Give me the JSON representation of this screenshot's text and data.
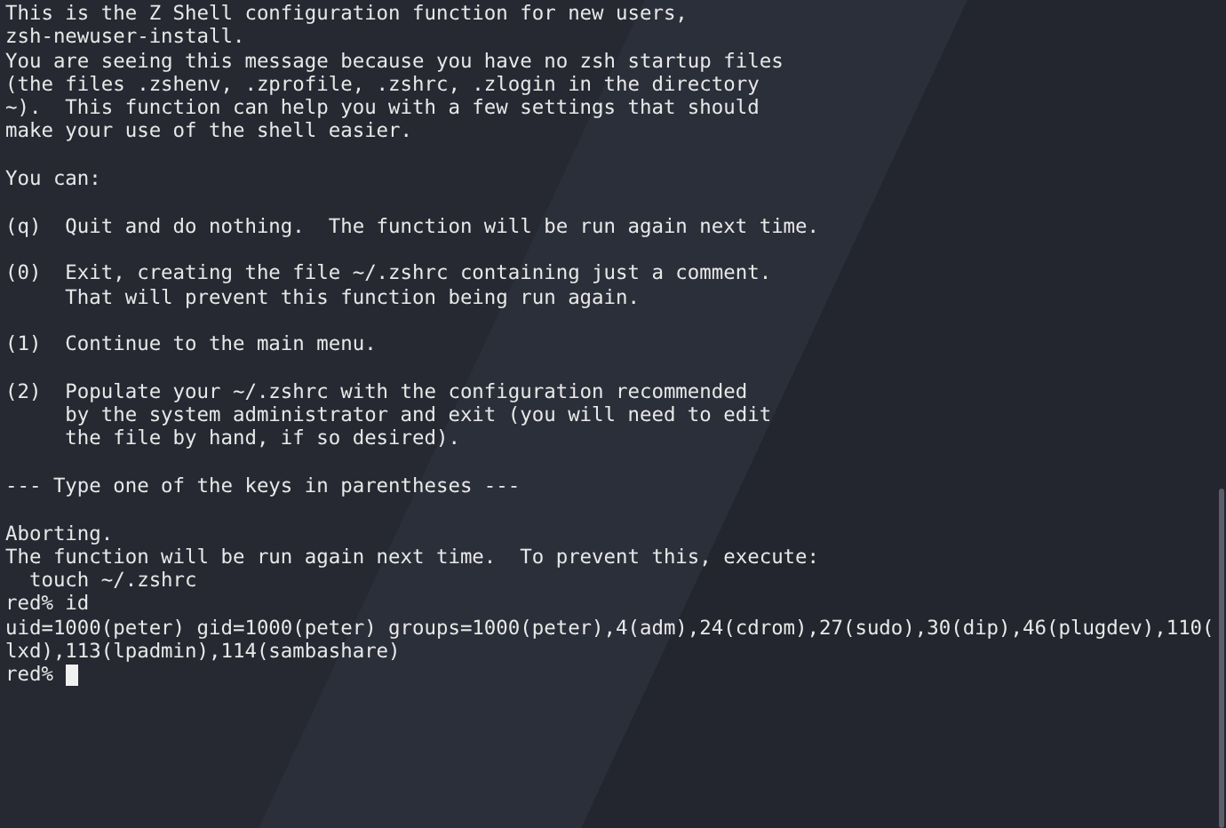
{
  "terminal": {
    "paragraphs": [
      [
        "This is the Z Shell configuration function for new users,",
        "zsh-newuser-install.",
        "You are seeing this message because you have no zsh startup files",
        "(the files .zshenv, .zprofile, .zshrc, .zlogin in the directory",
        "~).  This function can help you with a few settings that should",
        "make your use of the shell easier."
      ],
      [
        "You can:"
      ],
      [
        "(q)  Quit and do nothing.  The function will be run again next time."
      ],
      [
        "(0)  Exit, creating the file ~/.zshrc containing just a comment.",
        "     That will prevent this function being run again."
      ],
      [
        "(1)  Continue to the main menu."
      ],
      [
        "(2)  Populate your ~/.zshrc with the configuration recommended",
        "     by the system administrator and exit (you will need to edit",
        "     the file by hand, if so desired)."
      ],
      [
        "--- Type one of the keys in parentheses ---"
      ],
      [
        "Aborting.",
        "The function will be run again next time.  To prevent this, execute:",
        "  touch ~/.zshrc",
        "red% id",
        "uid=1000(peter) gid=1000(peter) groups=1000(peter),4(adm),24(cdrom),27(sudo),30(dip),46(plugdev),110(",
        "lxd),113(lpadmin),114(sambashare)"
      ]
    ],
    "prompt": "red% ",
    "cursor": true
  }
}
